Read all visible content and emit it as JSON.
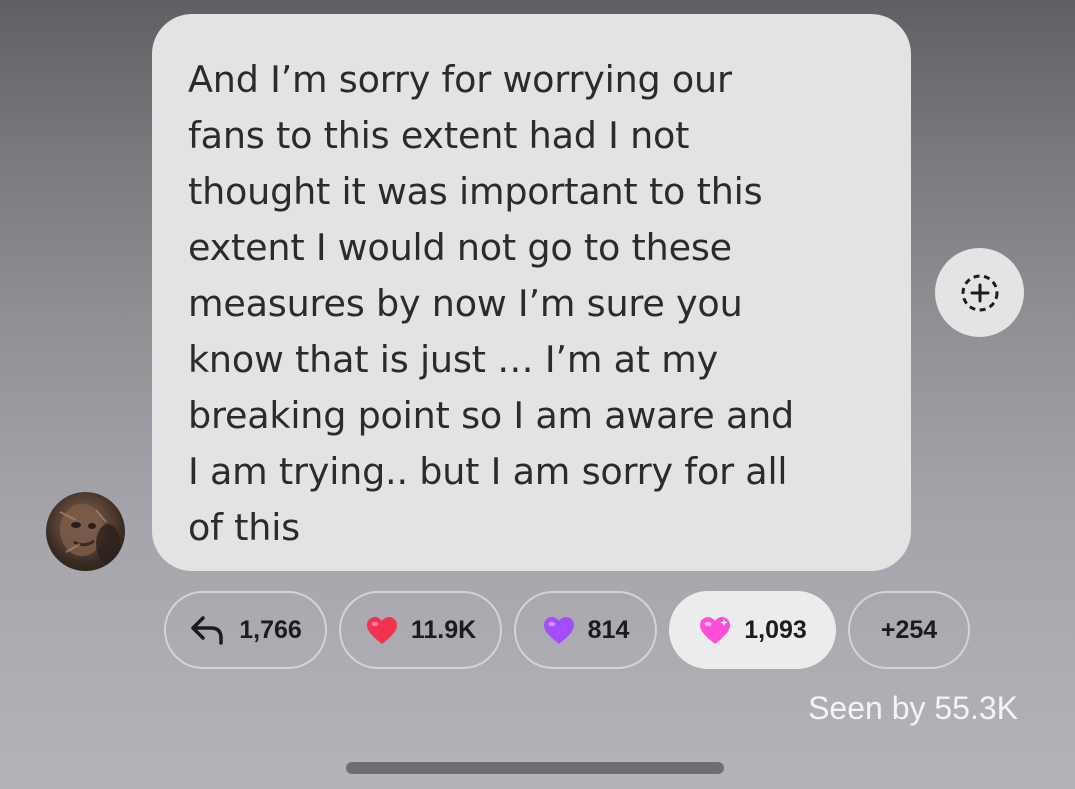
{
  "message": {
    "text": "And I’m sorry for worrying our\nfans to this extent had I not\nthought it was important to this\nextent I would not go to these\nmeasures by now I’m sure you\nknow that is just … I’m at my\nbreaking point so I am aware and\nI am trying.. but I am sorry for all\nof this"
  },
  "avatar": {
    "icon": "user-avatar-photo"
  },
  "add_reaction": {
    "icon": "add-reaction-icon"
  },
  "reactions": [
    {
      "icon": "reply-arrow-icon",
      "count": "1,766"
    },
    {
      "icon": "red-heart-icon",
      "count": "11.9K",
      "color": "#f0344f"
    },
    {
      "icon": "purple-heart-icon",
      "count": "814",
      "color": "#a34dff"
    },
    {
      "icon": "pink-heart-icon",
      "count": "1,093",
      "color": "#ff4fd8",
      "selected": true
    },
    {
      "label": "+254"
    }
  ],
  "seen": {
    "text": "Seen by 55.3K"
  }
}
